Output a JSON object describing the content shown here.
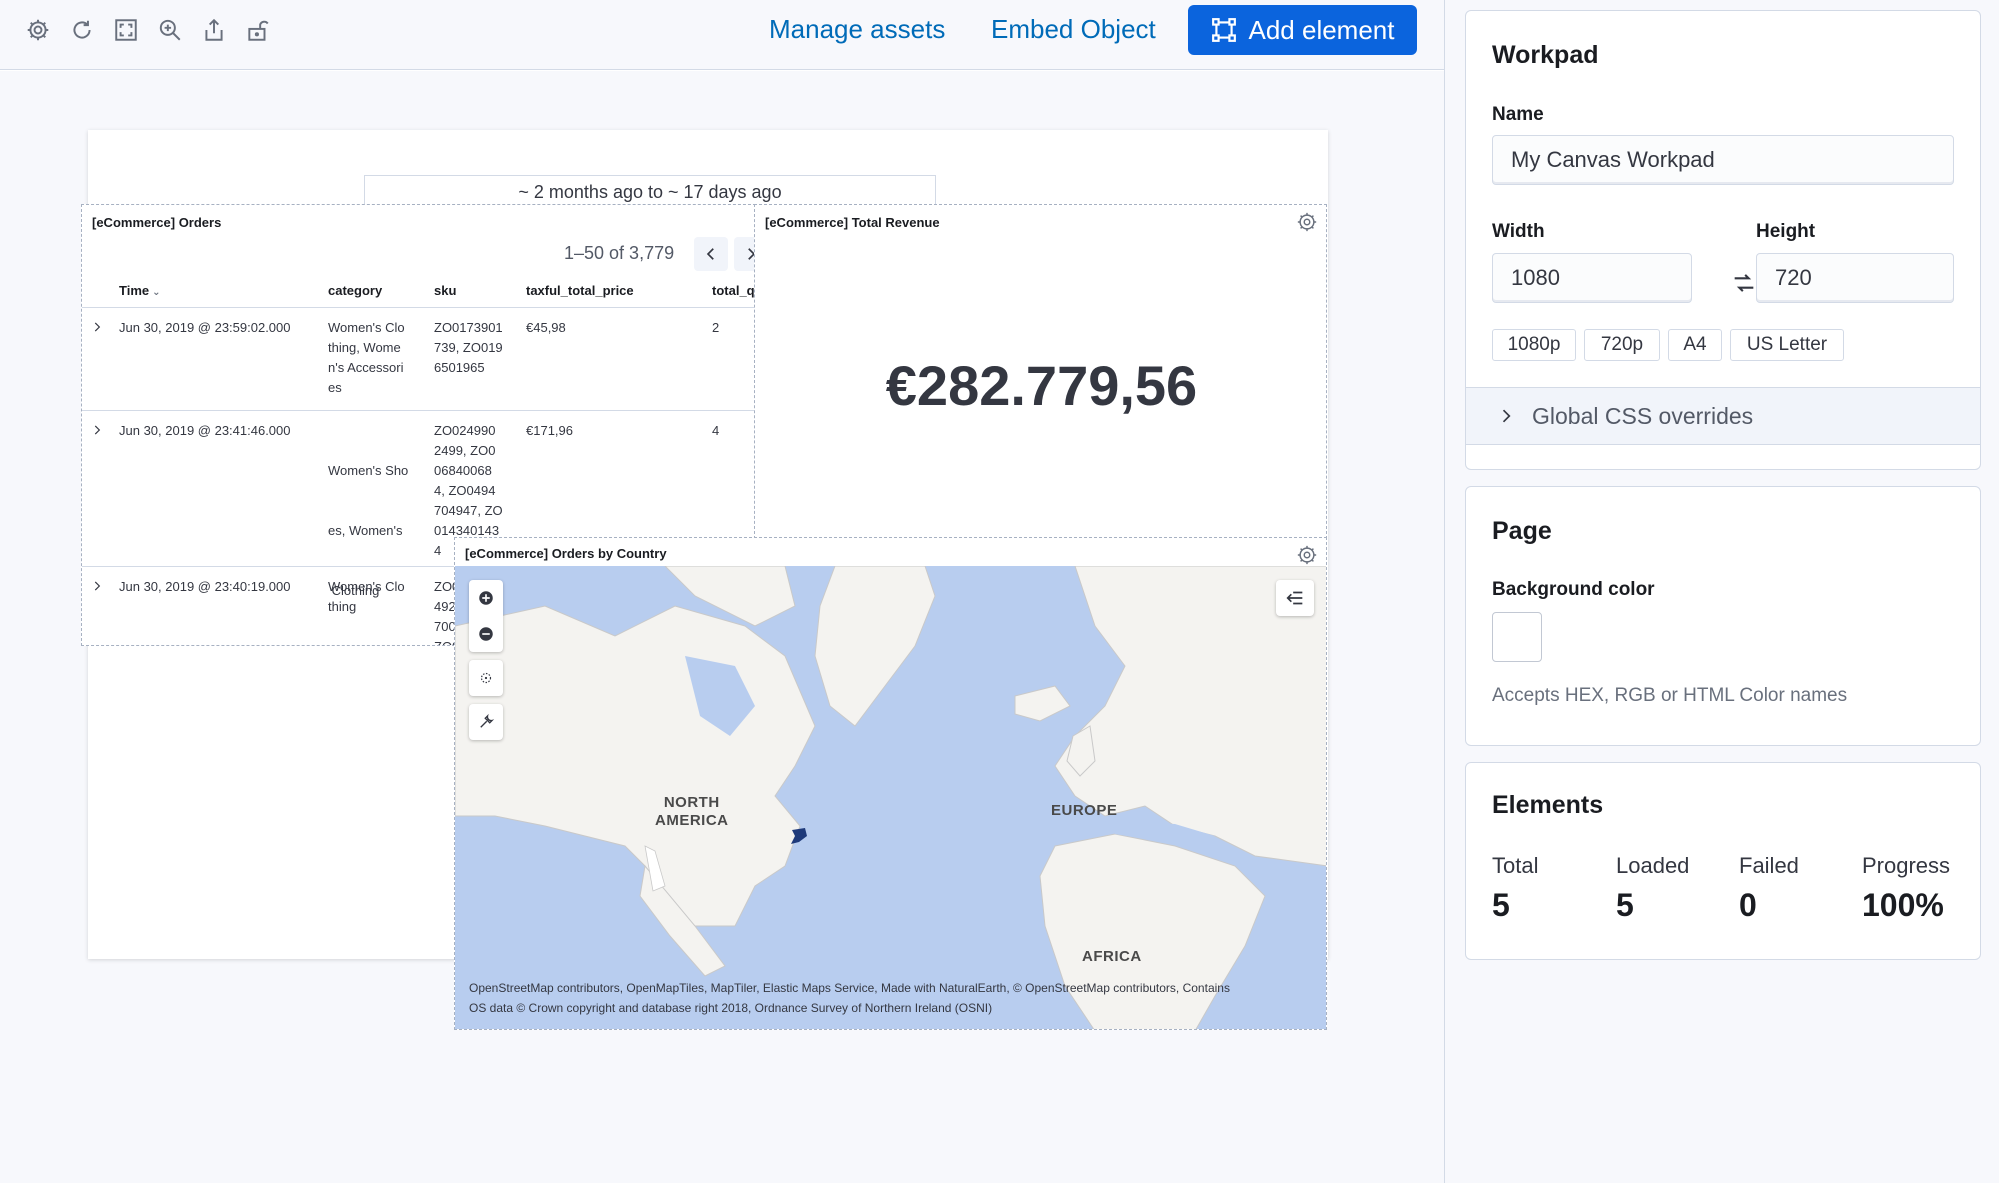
{
  "toolbar": {
    "icons": [
      "settings-icon",
      "refresh-icon",
      "fullscreen-icon",
      "zoom-icon",
      "share-icon",
      "lock-icon"
    ],
    "manage_assets_label": "Manage assets",
    "embed_object_label": "Embed Object",
    "add_element_label": "Add element"
  },
  "canvas": {
    "time_filter": "~ 2 months ago to ~ 17 days ago",
    "orders": {
      "title": "[eCommerce] Orders",
      "pagination": "1–50 of 3,779",
      "columns": [
        "Time",
        "category",
        "sku",
        "taxful_total_price",
        "total_q"
      ],
      "rows": [
        {
          "time": "Jun 30, 2019 @ 23:59:02.000",
          "category": [
            "Women's Clo",
            "thing, Wome",
            "n's Accessori",
            "es"
          ],
          "sku": [
            "ZO0173901",
            "739, ZO019",
            "6501965"
          ],
          "price": "€45,98",
          "qty": "2"
        },
        {
          "time": "Jun 30, 2019 @ 23:41:46.000",
          "category": [
            "Women's Sho",
            "es, Women's",
            " Clothing"
          ],
          "sku": [
            "ZO024990",
            "2499, ZO0",
            "06840068",
            "4, ZO0494",
            "704947, ZO",
            "014340143",
            "4"
          ],
          "price": "€171,96",
          "qty": "4"
        },
        {
          "time": "Jun 30, 2019 @ 23:40:19.000",
          "category": [
            "Women's Clo",
            "thing"
          ],
          "sku": [
            "ZO0",
            "492",
            "700",
            "ZO0"
          ],
          "price": "",
          "qty": ""
        }
      ]
    },
    "revenue": {
      "title": "[eCommerce] Total Revenue",
      "value": "€282.779,56"
    },
    "map": {
      "title": "[eCommerce] Orders by Country",
      "labels": {
        "north_america_1": "NORTH",
        "north_america_2": "AMERICA",
        "europe": "EUROPE",
        "africa": "AFRICA"
      },
      "attribution_1": "OpenStreetMap contributors, OpenMapTiles, MapTiler, Elastic Maps Service, Made with NaturalEarth, © OpenStreetMap contributors, Contains",
      "attribution_2": "OS data © Crown copyright and database right 2018, Ordnance Survey of Northern Ireland (OSNI)"
    }
  },
  "sidebar": {
    "workpad": {
      "title": "Workpad",
      "name_label": "Name",
      "name_value": "My Canvas Workpad",
      "width_label": "Width",
      "width_value": "1080",
      "height_label": "Height",
      "height_value": "720",
      "presets": [
        "1080p",
        "720p",
        "A4",
        "US Letter"
      ],
      "css_overrides_label": "Global CSS overrides"
    },
    "page": {
      "title": "Page",
      "bg_label": "Background color",
      "bg_value": "#ffffff",
      "help": "Accepts HEX, RGB or HTML Color names"
    },
    "elements": {
      "title": "Elements",
      "stats": [
        {
          "label": "Total",
          "value": "5"
        },
        {
          "label": "Loaded",
          "value": "5"
        },
        {
          "label": "Failed",
          "value": "0"
        },
        {
          "label": "Progress",
          "value": "100%"
        }
      ]
    }
  },
  "colors": {
    "accent": "#0b64dd",
    "link": "#006bb8",
    "map_ocean": "#b8cdef",
    "map_land": "#f4f3f0",
    "map_highlight": "#1f3a7a"
  }
}
